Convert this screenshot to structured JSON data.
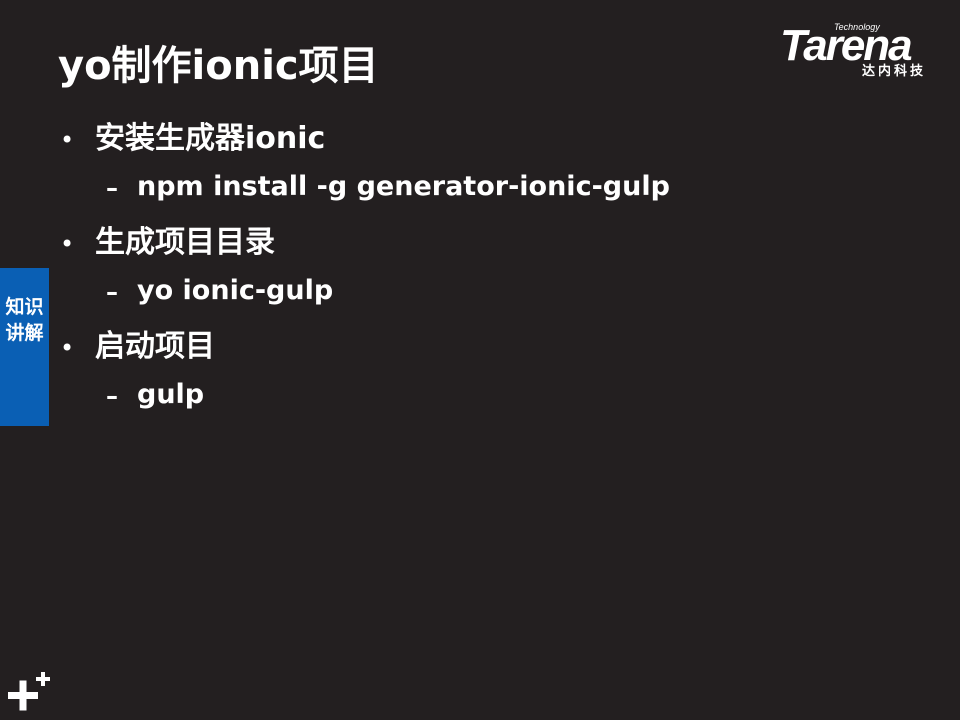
{
  "slide": {
    "title": "yo制作ionic项目",
    "bullets": [
      {
        "text": "安装生成器ionic",
        "sub": "npm install -g generator-ionic-gulp"
      },
      {
        "text": "生成项目目录",
        "sub": "yo ionic-gulp"
      },
      {
        "text": "启动项目",
        "sub": "gulp"
      }
    ],
    "bullet_symbol": "•",
    "sub_symbol": "–"
  },
  "logo": {
    "tagline": "Technology",
    "brand": "Tarena",
    "chinese": "达内科技"
  },
  "side_tab": {
    "label": "知识讲解"
  },
  "colors": {
    "background": "#231f20",
    "text": "#ffffff",
    "side_tab": "#0a5fb4"
  }
}
